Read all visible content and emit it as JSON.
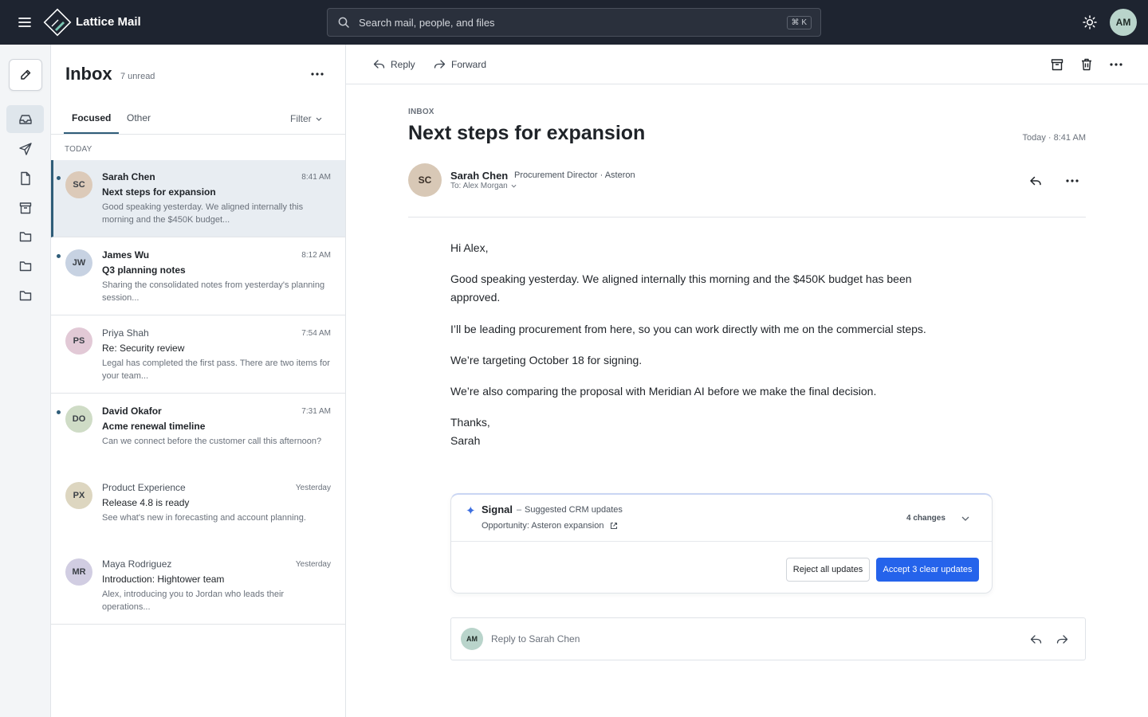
{
  "app": {
    "title": "Lattice Mail",
    "search_placeholder": "Search mail, people, and files",
    "search_shortcut": "⌘ K",
    "user_initials": "AM"
  },
  "rail": {
    "items": [
      {
        "icon": "inbox-icon",
        "active": true
      },
      {
        "icon": "send-icon",
        "active": false
      },
      {
        "icon": "document-icon",
        "active": false
      },
      {
        "icon": "archive-icon",
        "active": false
      },
      {
        "icon": "folder-icon",
        "active": false
      },
      {
        "icon": "folder-icon",
        "active": false
      },
      {
        "icon": "folder-icon",
        "active": false
      }
    ]
  },
  "list": {
    "title": "Inbox",
    "unread": "7 unread",
    "tabs": [
      "Focused",
      "Other"
    ],
    "filter": "Filter",
    "day_label": "TODAY",
    "messages": [
      {
        "initials": "SC",
        "sender": "Sarah Chen",
        "time": "8:41 AM",
        "subject": "Next steps for expansion",
        "preview": "Good speaking yesterday. We aligned internally this morning and the $450K budget...",
        "unread": true,
        "selected": true,
        "avatar_color": "#dccab9"
      },
      {
        "initials": "JW",
        "sender": "James Wu",
        "time": "8:12 AM",
        "subject": "Q3 planning notes",
        "preview": "Sharing the consolidated notes from yesterday's planning session...",
        "unread": true,
        "selected": false,
        "avatar_color": "#c7d2e2"
      },
      {
        "initials": "PS",
        "sender": "Priya Shah",
        "time": "7:54 AM",
        "subject": "Re: Security review",
        "preview": "Legal has completed the first pass. There are two items for your team...",
        "unread": false,
        "selected": false,
        "avatar_color": "#e2c9d6"
      },
      {
        "initials": "DO",
        "sender": "David Okafor",
        "time": "7:31 AM",
        "subject": "Acme renewal timeline",
        "preview": "Can we connect before the customer call this afternoon?",
        "unread": true,
        "selected": false,
        "avatar_color": "#cfdcc6"
      },
      {
        "initials": "PX",
        "sender": "Product Experience",
        "time": "Yesterday",
        "subject": "Release 4.8 is ready",
        "preview": "See what's new in forecasting and account planning.",
        "unread": false,
        "selected": false,
        "avatar_color": "#ddd6c0"
      },
      {
        "initials": "MR",
        "sender": "Maya Rodriguez",
        "time": "Yesterday",
        "subject": "Introduction: Hightower team",
        "preview": "Alex, introducing you to Jordan who leads their operations...",
        "unread": false,
        "selected": false,
        "avatar_color": "#d1cde2"
      }
    ]
  },
  "toolbar": {
    "reply": "Reply",
    "forward": "Forward"
  },
  "email": {
    "folder": "INBOX",
    "subject": "Next steps for expansion",
    "date": "Today · 8:41 AM",
    "sender_initials": "SC",
    "sender_name": "Sarah Chen",
    "sender_role": "Procurement Director · Asteron",
    "recipient": "To: Alex Morgan",
    "body": [
      "Hi Alex,",
      "Good speaking yesterday. We aligned internally this morning and the $450K budget has been approved.",
      "I’ll be leading procurement from here, so you can work directly with me on the commercial steps.",
      "We’re targeting October 18 for signing.",
      "We’re also comparing the proposal with Meridian AI before we make the final decision.",
      "Thanks,",
      "Sarah"
    ]
  },
  "signal": {
    "name": "Signal",
    "dash": "–",
    "subtitle": "Suggested CRM updates",
    "opportunity": "Opportunity: Asteron expansion",
    "changes": "4 changes",
    "reject": "Reject all updates",
    "accept": "Accept 3 clear updates",
    "accent": "#2563eb"
  },
  "reply_box": {
    "initials": "AM",
    "placeholder": "Reply to Sarah Chen"
  }
}
